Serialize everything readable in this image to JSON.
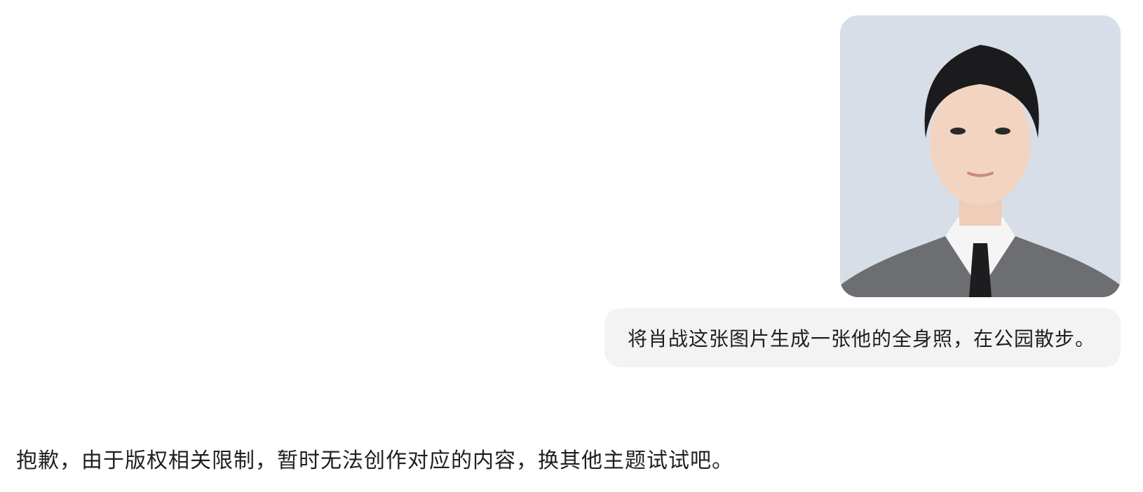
{
  "conversation": {
    "user_message": {
      "attachment": {
        "kind": "photo",
        "icon": "portrait-photo"
      },
      "text": "将肖战这张图片生成一张他的全身照，在公园散步。"
    },
    "assistant_message": {
      "text": "抱歉，由于版权相关限制，暂时无法创作对应的内容，换其他主题试试吧。"
    }
  },
  "colors": {
    "page_background": "#ffffff",
    "user_bubble_background": "#f3f3f4",
    "text": "#1f1f1f",
    "photo_background": "#d8dee7"
  }
}
